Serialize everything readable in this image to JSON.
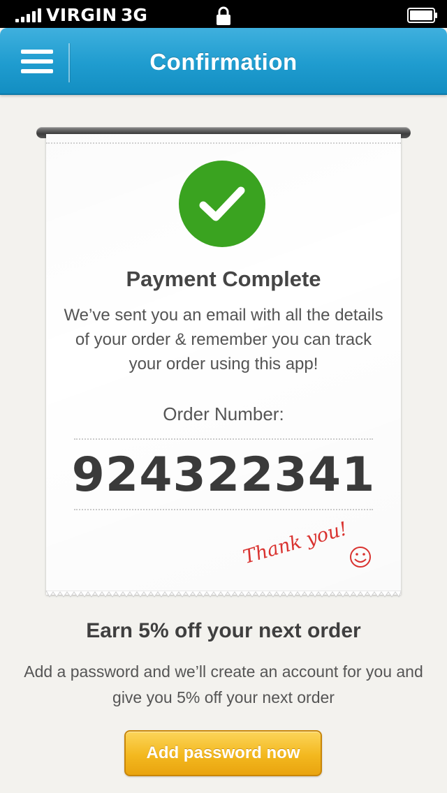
{
  "status_bar": {
    "carrier": "VIRGIN",
    "network": "3G",
    "icons": [
      "signal-icon",
      "lock-icon",
      "battery-icon"
    ]
  },
  "nav": {
    "title": "Confirmation",
    "menu_icon": "hamburger-menu-icon"
  },
  "receipt": {
    "status_icon": "checkmark-icon",
    "title": "Payment Complete",
    "message": "We’ve sent you an email with all the details of your order & remember you can track your order using this app!",
    "order_label": "Order Number:",
    "order_number": "924322341",
    "signature": "Thank you!",
    "signature_icon": "smiley-icon"
  },
  "promo": {
    "title": "Earn 5% off your next order",
    "body": "Add a password and we’ll create an account for you and give you 5% off your next order",
    "button_label": "Add password now"
  },
  "colors": {
    "nav_blue": "#1f9ccf",
    "success_green": "#3aa320",
    "signature_red": "#d9322f",
    "button_yellow": "#f3b81f",
    "background": "#f3f2ee"
  }
}
